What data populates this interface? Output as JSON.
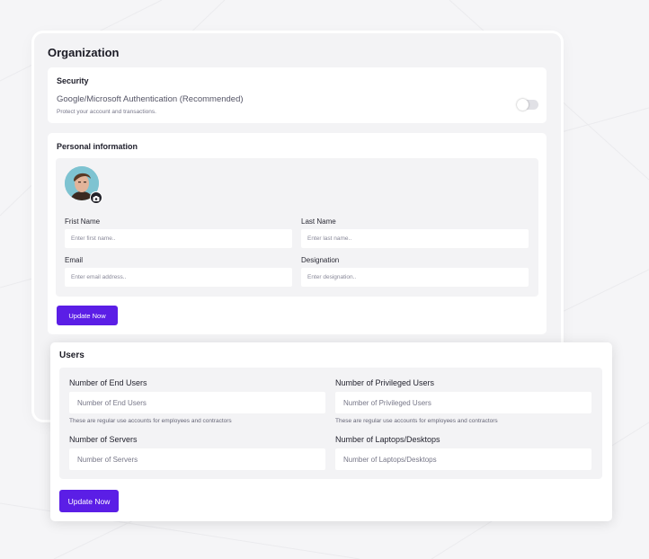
{
  "organization": {
    "title": "Organization",
    "security": {
      "title": "Security",
      "option_name": "Google/Microsoft Authentication (Recommended)",
      "option_description": "Protect your account and transactions.",
      "toggle_on": false
    },
    "personal_info": {
      "title": "Personal information",
      "fields": {
        "first_name": {
          "label": "Frist Name",
          "placeholder": "Enter first name..",
          "value": ""
        },
        "last_name": {
          "label": "Last Name",
          "placeholder": "Enter last name..",
          "value": ""
        },
        "email": {
          "label": "Email",
          "placeholder": "Enter email address..",
          "value": ""
        },
        "designation": {
          "label": "Designation",
          "placeholder": "Enter designation..",
          "value": ""
        }
      },
      "update_button": "Update Now"
    }
  },
  "users": {
    "title": "Users",
    "fields": {
      "end_users": {
        "label": "Number of End Users",
        "placeholder": "Number of End Users",
        "hint": "These are regular use accounts for employees and contractors"
      },
      "privileged_users": {
        "label": "Number of Privileged Users",
        "placeholder": "Number of Privileged Users",
        "hint": "These are regular use accounts for employees and contractors"
      },
      "servers": {
        "label": "Number of Servers",
        "placeholder": "Number of Servers"
      },
      "laptops": {
        "label": "Number of Laptops/Desktops",
        "placeholder": "Number of Laptops/Desktops"
      }
    },
    "update_button": "Update Now"
  },
  "colors": {
    "accent": "#5b1ee6",
    "panel_bg": "#f3f3f5",
    "card_bg": "#ffffff",
    "toggle_off": "#e1e1e6"
  },
  "icons": {
    "camera": "camera-icon",
    "avatar": "user-avatar-photo"
  }
}
